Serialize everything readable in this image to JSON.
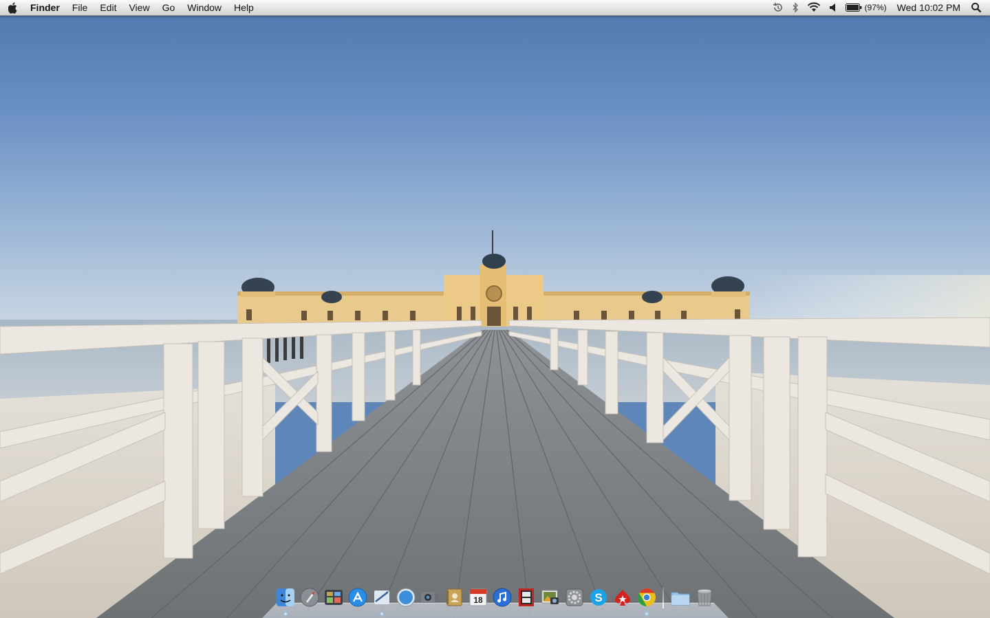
{
  "menubar": {
    "app_name": "Finder",
    "items": [
      "File",
      "Edit",
      "View",
      "Go",
      "Window",
      "Help"
    ],
    "battery_percent": "(97%)",
    "clock": "Wed 10:02 PM"
  },
  "dock": {
    "apps": [
      {
        "name": "finder-icon",
        "color": "#3f86d8",
        "running": true
      },
      {
        "name": "launchpad-icon",
        "color": "#8a8f97",
        "running": false
      },
      {
        "name": "mission-control-icon",
        "color": "#3a3f48",
        "running": false
      },
      {
        "name": "app-store-icon",
        "color": "#2a8ee8",
        "running": false
      },
      {
        "name": "mail-icon",
        "color": "#6f9fd8",
        "running": true
      },
      {
        "name": "safari-icon",
        "color": "#3a8fd8",
        "running": false
      },
      {
        "name": "facetime-icon",
        "color": "#7a7f88",
        "running": false
      },
      {
        "name": "contacts-icon",
        "color": "#c9a35a",
        "running": false
      },
      {
        "name": "calendar-icon",
        "color": "#e8e8e8",
        "running": false
      },
      {
        "name": "itunes-icon",
        "color": "#2a6fd8",
        "running": false
      },
      {
        "name": "photo-booth-icon",
        "color": "#c22424",
        "running": false
      },
      {
        "name": "iphoto-icon",
        "color": "#6d8a3a",
        "running": false
      },
      {
        "name": "system-preferences-icon",
        "color": "#8d9096",
        "running": false
      },
      {
        "name": "skype-icon",
        "color": "#1aa3e8",
        "running": false
      },
      {
        "name": "pokerstars-icon",
        "color": "#d8201e",
        "running": false
      },
      {
        "name": "chrome-icon",
        "color": "#e8c020",
        "running": true
      }
    ],
    "stacks": [
      {
        "name": "applications-folder-icon",
        "color": "#9cc4e8"
      },
      {
        "name": "trash-icon",
        "color": "#a8adb5"
      }
    ],
    "calendar_day": "18"
  }
}
